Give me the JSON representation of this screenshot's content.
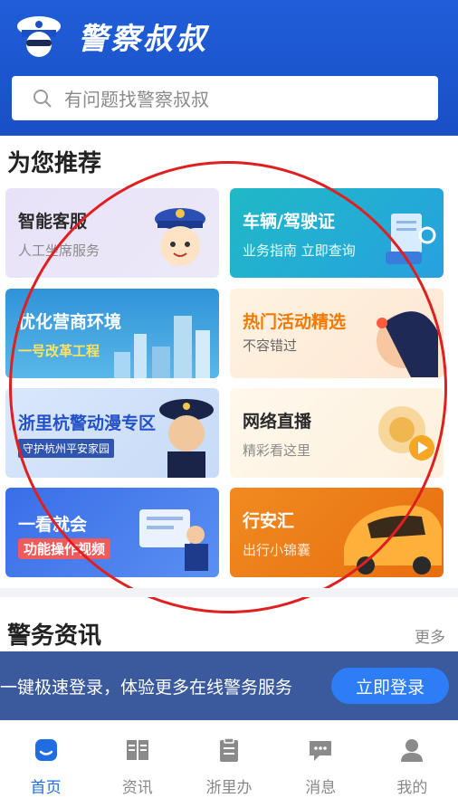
{
  "app": {
    "title": "警察叔叔",
    "brand_color": "#1f5ed8"
  },
  "search": {
    "placeholder": "有问题找警察叔叔",
    "icon": "search-icon"
  },
  "recommend": {
    "title": "为您推荐",
    "cards": [
      {
        "title": "智能客服",
        "subtitle": "人工坐席服务",
        "title_color": "#2a2a2a",
        "sub_color": "#8b8b8b"
      },
      {
        "title": "车辆/驾驶证",
        "subtitle": "业务指南 立即查询",
        "title_color": "#ffffff",
        "sub_color": "#e8fffb"
      },
      {
        "title": "优化营商环境",
        "subtitle": "一号改革工程",
        "title_color": "#ffffff",
        "sub_color": "#ffe45c"
      },
      {
        "title": "热门活动精选",
        "subtitle": "不容错过",
        "title_color": "#f07a00",
        "sub_color": "#666666"
      },
      {
        "title": "浙里杭警动漫专区",
        "subtitle": "守护杭州平安家园",
        "title_color": "#2450c8",
        "sub_color": "#ffffff"
      },
      {
        "title": "网络直播",
        "subtitle": "精彩看这里",
        "title_color": "#2a2a2a",
        "sub_color": "#8b8b8b"
      },
      {
        "title": "一看就会",
        "subtitle": "功能操作视频",
        "title_color": "#ffffff",
        "sub_color": "#ffffff"
      },
      {
        "title": "行安汇",
        "subtitle": "出行小锦囊",
        "title_color": "#ffffff",
        "sub_color": "#ffe7cf"
      }
    ]
  },
  "news": {
    "title": "警务资讯",
    "more": "更多"
  },
  "login_banner": {
    "text": "一键极速登录，体验更多在线警务服务",
    "button": "立即登录"
  },
  "nav": [
    {
      "label": "首页",
      "icon": "home-icon",
      "active": true
    },
    {
      "label": "资讯",
      "icon": "book-icon",
      "active": false
    },
    {
      "label": "浙里办",
      "icon": "clipboard-icon",
      "active": false
    },
    {
      "label": "消息",
      "icon": "chat-icon",
      "active": false
    },
    {
      "label": "我的",
      "icon": "person-icon",
      "active": false
    }
  ]
}
